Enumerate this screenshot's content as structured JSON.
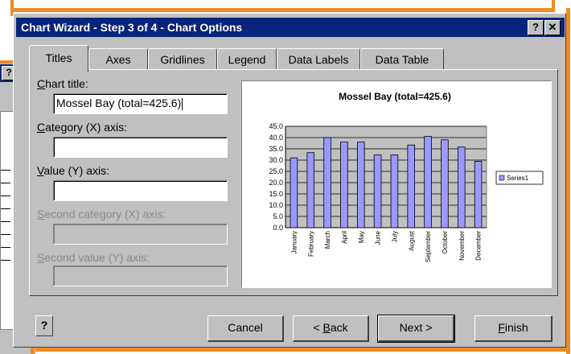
{
  "window": {
    "title": "Chart Wizard - Step 3 of 4 - Chart Options",
    "help_btn": "?",
    "close_btn": "✕"
  },
  "background_window": {
    "help_btn": "?",
    "close_btn": "✕"
  },
  "tabs": [
    "Titles",
    "Axes",
    "Gridlines",
    "Legend",
    "Data Labels",
    "Data Table"
  ],
  "active_tab": "Titles",
  "form": {
    "chart_title_label_u": "C",
    "chart_title_label_rest": "hart title:",
    "chart_title_value": "Mossel Bay (total=425.6)",
    "category_label_u": "C",
    "category_label_rest": "ategory (X) axis:",
    "category_value": "",
    "value_label_u": "V",
    "value_label_rest": "alue (Y) axis:",
    "value_value": "",
    "second_category_label_u": "S",
    "second_category_label_rest": "econd category (X) axis:",
    "second_value_label_u": "S",
    "second_value_label_rest": "econd value (Y) axis:"
  },
  "buttons": {
    "help_icon": "?",
    "cancel": "Cancel",
    "back_prefix": "< ",
    "back_u": "B",
    "back_rest": "ack",
    "next": "Next >",
    "finish_u": "F",
    "finish_rest": "inish"
  },
  "chart_data": {
    "type": "bar",
    "title": "Mossel Bay (total=425.6)",
    "categories": [
      "January",
      "February",
      "March",
      "April",
      "May",
      "June",
      "July",
      "August",
      "September",
      "October",
      "November",
      "December"
    ],
    "series": [
      {
        "name": "Series1",
        "values": [
          31.0,
          33.3,
          40.0,
          38.0,
          38.0,
          32.3,
          32.3,
          36.7,
          40.5,
          39.0,
          35.8,
          29.5
        ]
      }
    ],
    "yticks": [
      "45.0",
      "40.0",
      "35.0",
      "30.0",
      "25.0",
      "20.0",
      "15.0",
      "10.0",
      "5.0",
      "0.0"
    ],
    "ylim": [
      0,
      45
    ],
    "grid": true,
    "legend_position": "right",
    "bar_color": "#9999ff",
    "plot_bg": "#c0c0c0"
  }
}
